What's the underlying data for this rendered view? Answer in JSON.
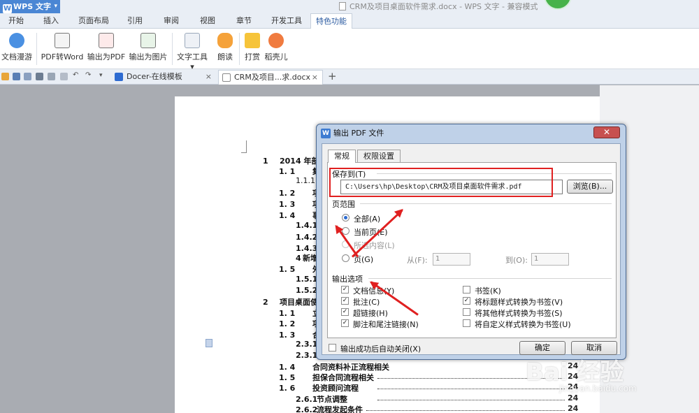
{
  "app": {
    "menu_button": "WPS 文字",
    "window_title": "CRM及项目桌面软件需求.docx - WPS 文字 - 兼容模式"
  },
  "ribbon_tabs": [
    "开始",
    "插入",
    "页面布局",
    "引用",
    "审阅",
    "视图",
    "章节",
    "开发工具",
    "特色功能"
  ],
  "ribbon_buttons": [
    "文档漫游",
    "PDF转Word",
    "输出为PDF",
    "输出为图片",
    "文字工具 ▾",
    "朗读",
    "打赏",
    "稻壳儿"
  ],
  "doc_tabs": [
    {
      "label": "Docer-在线模板",
      "close": "×"
    },
    {
      "label": "CRM及项目...求.docx",
      "close": "×"
    }
  ],
  "new_tab": "+",
  "toc": [
    {
      "num": "1",
      "text": "2014 年部"
    },
    {
      "num": "1. 1",
      "text": "集"
    },
    {
      "num": "1.1.1",
      "text": ""
    },
    {
      "num": "1. 2",
      "text": "项"
    },
    {
      "num": "1. 3",
      "text": "项"
    },
    {
      "num": "1. 4",
      "text": "事"
    },
    {
      "num": "1.4.1",
      "text": ""
    },
    {
      "num": "1.4.2",
      "text": "工"
    },
    {
      "num": "1.4.3",
      "text": "项"
    },
    {
      "num": "4",
      "text": "新增"
    },
    {
      "num": "1. 5",
      "text": "外"
    },
    {
      "num": "1.5.1",
      "text": ""
    },
    {
      "num": "1.5.2",
      "text": "T"
    },
    {
      "num": "2",
      "text": "项目桌面使"
    },
    {
      "num": "1. 1",
      "text": "立"
    },
    {
      "num": "1. 2",
      "text": "项"
    },
    {
      "num": "1. 3",
      "text": "合"
    },
    {
      "num": "2.3.1",
      "text": ""
    },
    {
      "num": "2.3.1",
      "text": ""
    },
    {
      "num": "1. 4",
      "text": "合同资料补正流程相关"
    },
    {
      "num": "1. 5",
      "text": "担保合同流程相关"
    },
    {
      "num": "1. 6",
      "text": "投资顾问流程"
    },
    {
      "num": "2.6.1",
      "text": "节点调整"
    },
    {
      "num": "2.6.2",
      "text": "流程发起条件"
    }
  ],
  "page_numbers": [
    "24",
    "24",
    "24",
    "24",
    "24"
  ],
  "dialog": {
    "title": "输出 PDF 文件",
    "close": "✕",
    "tabs": [
      "常规",
      "权限设置"
    ],
    "save_to_label": "保存到(T)",
    "save_path": "C:\\Users\\hp\\Desktop\\CRM及项目桌面软件需求.pdf",
    "browse": "浏览(B)...",
    "range_label": "页范围",
    "range_options": [
      {
        "label": "全部(A)",
        "checked": true,
        "disabled": false
      },
      {
        "label": "当前页(E)",
        "checked": false,
        "disabled": false
      },
      {
        "label": "所选内容(L)",
        "checked": false,
        "disabled": true
      },
      {
        "label": "页(G)",
        "checked": false,
        "disabled": false
      }
    ],
    "from_label": "从(F):",
    "from_value": "1",
    "to_label": "到(O):",
    "to_value": "1",
    "output_label": "输出选项",
    "options_left": [
      {
        "label": "文档信息(Y)",
        "checked": true
      },
      {
        "label": "批注(C)",
        "checked": true
      },
      {
        "label": "超链接(H)",
        "checked": true
      },
      {
        "label": "脚注和尾注链接(N)",
        "checked": true
      }
    ],
    "options_right": [
      {
        "label": "书签(K)",
        "checked": false
      },
      {
        "label": "将标题样式转换为书签(V)",
        "checked": true
      },
      {
        "label": "将其他样式转换为书签(S)",
        "checked": false
      },
      {
        "label": "将自定义样式转换为书签(U)",
        "checked": false
      }
    ],
    "auto_close": "输出成功后自动关闭(X)",
    "auto_close_checked": false,
    "ok": "确定",
    "cancel": "取消"
  },
  "watermark": {
    "main": "Bai 经验",
    "sub": "jingyan.baidu.com"
  },
  "colors": {
    "accent": "#4a86d4",
    "annotation": "#e02020"
  }
}
